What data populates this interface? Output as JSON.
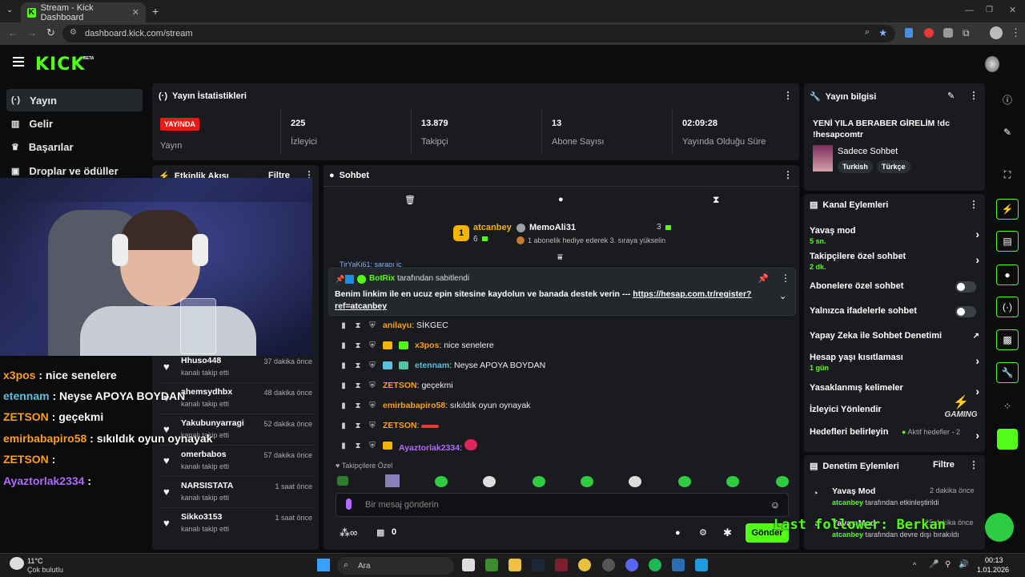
{
  "browser": {
    "tab_title": "Stream - Kick Dashboard",
    "url": "dashboard.kick.com/stream"
  },
  "brand": {
    "logo": "KICK",
    "beta": "BETA",
    "accent": "#53fc18"
  },
  "sidebar": {
    "items": [
      {
        "label": "Yayın",
        "icon": "broadcast-icon"
      },
      {
        "label": "Gelir",
        "icon": "revenue-icon"
      },
      {
        "label": "Başarılar",
        "icon": "trophy-icon"
      },
      {
        "label": "Droplar ve ödüller",
        "icon": "gift-icon"
      }
    ]
  },
  "stats": {
    "title": "Yayın İstatistikleri",
    "live_badge": "YAYINDA",
    "live_label": "Yayın",
    "viewers_value": "225",
    "viewers_label": "İzleyici",
    "followers_value": "13.879",
    "followers_label": "Takipçi",
    "subs_value": "13",
    "subs_label": "Abone Sayısı",
    "duration_value": "02:09:28",
    "duration_label": "Yayında Olduğu Süre"
  },
  "activity": {
    "title": "Etkinlik Akışı",
    "filter": "Filtre",
    "items": [
      {
        "name": "Hhuso448",
        "sub": "kanalı takip etti",
        "time": "37 dakika önce"
      },
      {
        "name": "ahemsydhbx",
        "sub": "kanalı takip etti",
        "time": "48 dakika önce"
      },
      {
        "name": "Yakubunyarragi",
        "sub": "kanalı takip etti",
        "time": "52 dakika önce"
      },
      {
        "name": "omerbabos",
        "sub": "kanalı takip etti",
        "time": "57 dakika önce"
      },
      {
        "name": "NARSISTATA",
        "sub": "kanalı takip etti",
        "time": "1 saat önce"
      },
      {
        "name": "Sikko3153",
        "sub": "kanalı takip etti",
        "time": "1 saat önce"
      }
    ]
  },
  "chat": {
    "title": "Sohbet",
    "leader1_name": "atcanbey",
    "leader1_rank": "1",
    "leader1_count": "6",
    "leader2_name": "MemoAli31",
    "leader2_count": "3",
    "leader2_sub": "1 abonelik hediye ederek 3. sıraya yükselin",
    "partial_line": "TirYaKi61: sarapı ic",
    "pinned_by_user": "BotRix",
    "pinned_by_text": "tarafından sabitlendi",
    "pinned_message": "Benim linkim ile en ucuz epin sitesine kaydolun ve banada destek verin --- ",
    "pinned_link": "https://hesap.com.tr/register?ref=atcanbey",
    "messages": [
      {
        "user": "anilayu",
        "color": "#ff9f1a",
        "text": "SİKGEC"
      },
      {
        "user": "x3pos",
        "color": "#ff9f1a",
        "text": "nice senelere"
      },
      {
        "user": "etennam",
        "color": "#5bc0de",
        "text": "Neyse APOYA BOYDAN"
      },
      {
        "user": "ZETSON",
        "color": "#ff9f1a",
        "text": "geçekmi"
      },
      {
        "user": "emirbabapiro58",
        "color": "#ff9f1a",
        "text": "sıkıldık oyun oynayak"
      },
      {
        "user": "ZETSON",
        "color": "#ff9f1a",
        "text": ""
      },
      {
        "user": "Ayaztorlak2334",
        "color": "#b36bff",
        "text": ""
      }
    ],
    "followers_only": "Takipçilere Özel",
    "input_placeholder": "Bir mesaj gönderin",
    "points": "0",
    "send": "Gönder"
  },
  "stream_info": {
    "title": "Yayın bilgisi",
    "stream_title": "YENİ YILA BERABER GİRELİM !dc !hesapcomtr",
    "category": "Sadece Sohbet",
    "tags": [
      "Turkish",
      "Türkçe"
    ]
  },
  "channel_actions": {
    "title": "Kanal Eylemleri",
    "slow_mode": "Yavaş mod",
    "slow_mode_value": "5 sn.",
    "followers_chat": "Takipçilere özel sohbet",
    "followers_chat_value": "2 dk.",
    "subs_chat": "Abonelere özel sohbet",
    "emotes_chat": "Yalnızca ifadelerle sohbet",
    "ai_mod": "Yapay Zeka ile Sohbet Denetimi",
    "age_restrict": "Hesap yaşı kısıtlaması",
    "age_restrict_value": "1 gün",
    "banned_words": "Yasaklanmış kelimeler",
    "viewer_redirect": "İzleyici Yönlendir",
    "goals": "Hedefleri belirleyin",
    "goals_status": "Aktif hedefler - 2"
  },
  "mod_actions": {
    "title": "Denetim Eylemleri",
    "filter": "Filtre",
    "items": [
      {
        "title": "Yavaş Mod",
        "time": "2 dakika önce",
        "user": "atcanbey",
        "text": "tarafından etkinleştirildi"
      },
      {
        "title": "Yavaş Mod",
        "time": "25 dakika önce",
        "user": "atcanbey",
        "text": "tarafından devre dışı bırakıldı"
      }
    ]
  },
  "overlay": {
    "lines": [
      {
        "user": "x3pos",
        "text": ": nice senelere",
        "color": "#ff9f1a"
      },
      {
        "user": "etennam",
        "text": ": Neyse APOYA BOYDAN",
        "color": "#5bc0de"
      },
      {
        "user": "ZETSON",
        "text": ": geçekmi",
        "color": "#ff9f1a"
      },
      {
        "user": "emirbabapiro58",
        "text": ": sıkıldık oyun oynayak",
        "color": "#ff9f1a"
      },
      {
        "user": "ZETSON",
        "text": ":",
        "color": "#ff9f1a"
      },
      {
        "user": "Ayaztorlak2334",
        "text": ":",
        "color": "#b36bff"
      }
    ],
    "last_follower": "Last follower: Berkan",
    "gaming_logo": "GAMING"
  },
  "taskbar": {
    "weather_temp": "11°C",
    "weather_desc": "Çok bulutlu",
    "search": "Ara",
    "time": "00:13",
    "date": "1.01.2026"
  }
}
